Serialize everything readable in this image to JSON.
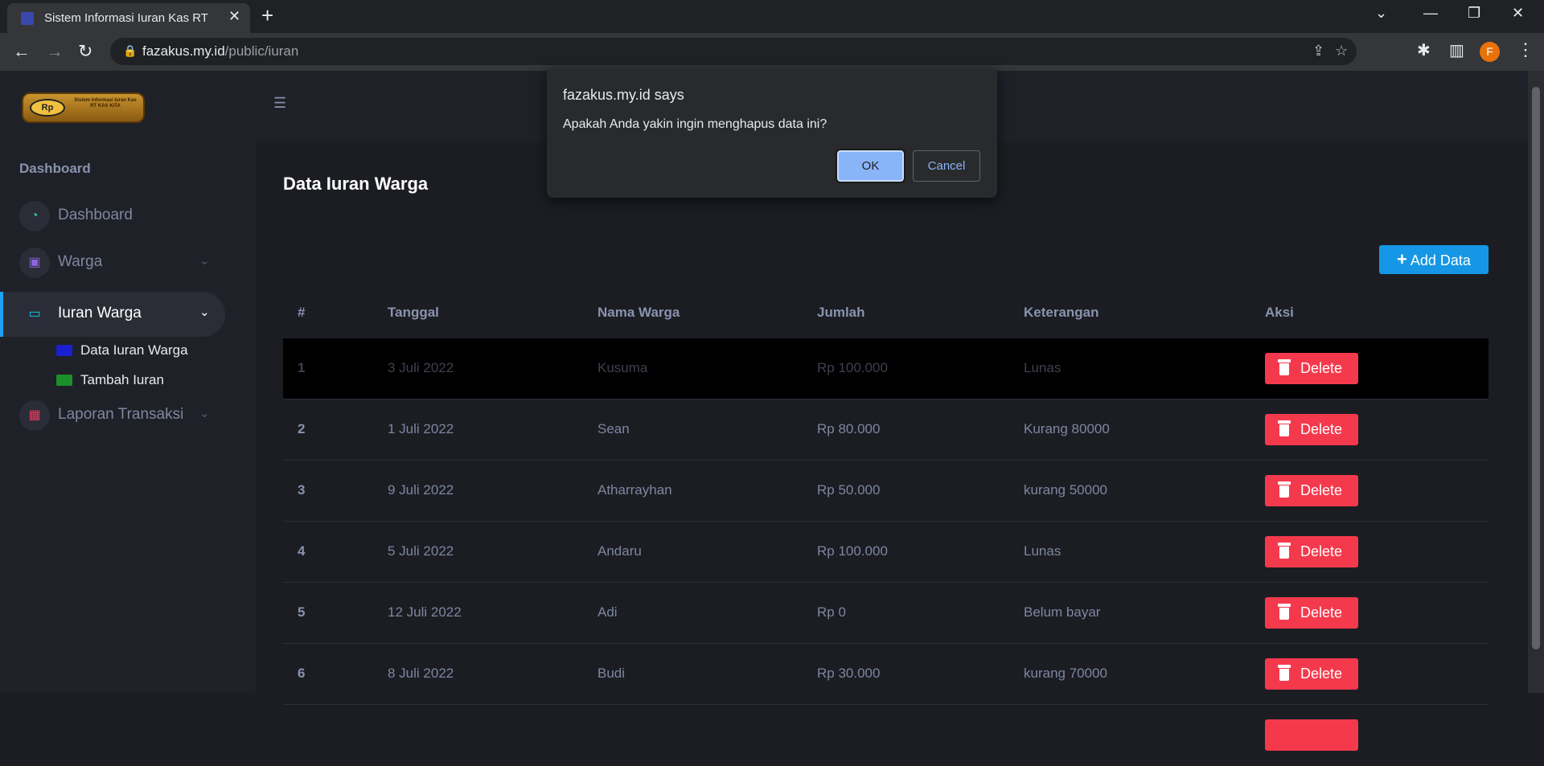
{
  "browser": {
    "tab_title": "Sistem Informasi Iuran Kas RT",
    "url_host": "fazakus.my.id",
    "url_path": "/public/iuran",
    "profile_initial": "F"
  },
  "logo": {
    "rp": "Rp",
    "caption": "Sistem Informasi Iuran Kas RT KAS KITA"
  },
  "sidebar": {
    "section": "Dashboard",
    "items": [
      {
        "label": "Dashboard"
      },
      {
        "label": "Warga"
      },
      {
        "label": "Iuran Warga"
      },
      {
        "label": "Laporan Transaksi"
      }
    ],
    "sub_items": [
      {
        "label": "Data Iuran Warga"
      },
      {
        "label": "Tambah Iuran"
      }
    ]
  },
  "main": {
    "title": "Data Iuran Warga",
    "add_button": "Add Data",
    "columns": [
      "#",
      "Tanggal",
      "Nama Warga",
      "Jumlah",
      "Keterangan",
      "Aksi"
    ],
    "delete_label": "Delete",
    "rows": [
      {
        "no": "1",
        "tanggal": "3 Juli 2022",
        "nama": "Kusuma",
        "jumlah": "Rp 100.000",
        "keterangan": "Lunas"
      },
      {
        "no": "2",
        "tanggal": "1 Juli 2022",
        "nama": "Sean",
        "jumlah": "Rp 80.000",
        "keterangan": "Kurang 80000"
      },
      {
        "no": "3",
        "tanggal": "9 Juli 2022",
        "nama": "Atharrayhan",
        "jumlah": "Rp 50.000",
        "keterangan": "kurang 50000"
      },
      {
        "no": "4",
        "tanggal": "5 Juli 2022",
        "nama": "Andaru",
        "jumlah": "Rp 100.000",
        "keterangan": "Lunas"
      },
      {
        "no": "5",
        "tanggal": "12 Juli 2022",
        "nama": "Adi",
        "jumlah": "Rp 0",
        "keterangan": "Belum bayar"
      },
      {
        "no": "6",
        "tanggal": "8 Juli 2022",
        "nama": "Budi",
        "jumlah": "Rp 30.000",
        "keterangan": "kurang 70000"
      }
    ]
  },
  "dialog": {
    "title": "fazakus.my.id says",
    "message": "Apakah Anda yakin ingin menghapus data ini?",
    "ok": "OK",
    "cancel": "Cancel"
  },
  "colors": {
    "accent": "#1da1f2",
    "add_button": "#1597e5",
    "delete_button": "#f5394d",
    "dialog_ok": "#8ab4f8"
  }
}
